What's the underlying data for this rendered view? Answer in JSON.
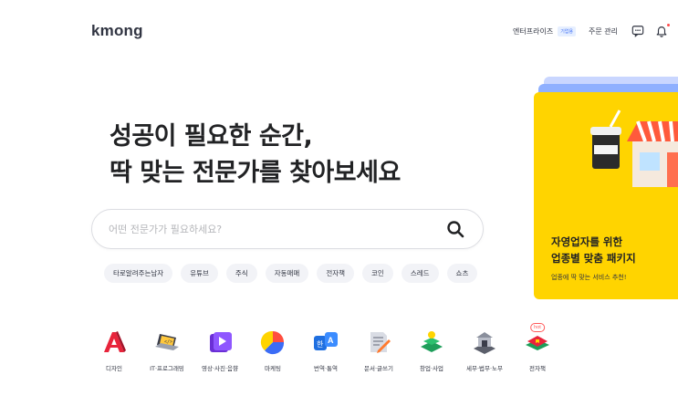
{
  "header": {
    "logo": "kmong",
    "enterprise_label": "엔터프라이즈",
    "enterprise_badge": "기업용",
    "orders_label": "주문 관리",
    "icons": [
      "chat-icon",
      "bell-icon"
    ]
  },
  "hero": {
    "line1": "성공이 필요한 순간,",
    "line2": "딱 맞는 전문가를 찾아보세요"
  },
  "search": {
    "placeholder": "어떤 전문가가 필요하세요?",
    "value": ""
  },
  "tags": [
    "타로알려주는남자",
    "유튜브",
    "주식",
    "자동매매",
    "전자책",
    "코인",
    "스레드",
    "쇼츠"
  ],
  "promo": {
    "title_line1": "자영업자를 위한",
    "title_line2": "업종별 맞춤 패키지",
    "subtitle": "업종에 딱 맞는 서비스 추천!",
    "colors": {
      "background": "#ffd400",
      "accent": "#8fb0ff"
    }
  },
  "categories": [
    {
      "label": "디자인",
      "icon": "design-icon"
    },
    {
      "label": "IT·프로그래밍",
      "icon": "laptop-code-icon"
    },
    {
      "label": "영상·사진·음향",
      "icon": "video-icon"
    },
    {
      "label": "마케팅",
      "icon": "pie-chart-icon"
    },
    {
      "label": "번역·통역",
      "icon": "translate-icon"
    },
    {
      "label": "문서·글쓰기",
      "icon": "document-pen-icon"
    },
    {
      "label": "창업·사업",
      "icon": "startup-icon"
    },
    {
      "label": "세무·법무·노무",
      "icon": "law-building-icon"
    },
    {
      "label": "전자책",
      "icon": "ebook-icon",
      "badge": "hot"
    }
  ]
}
